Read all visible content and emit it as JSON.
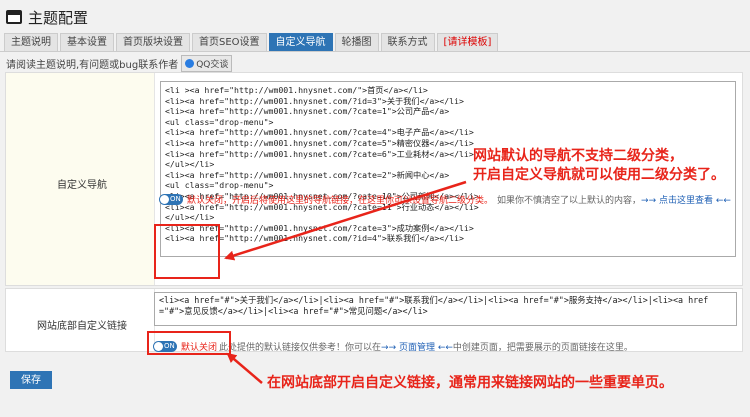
{
  "header": {
    "title": "主题配置"
  },
  "tabs": [
    {
      "label": "主题说明"
    },
    {
      "label": "基本设置"
    },
    {
      "label": "首页版块设置"
    },
    {
      "label": "首页SEO设置"
    },
    {
      "label": "自定义导航"
    },
    {
      "label": "轮播图"
    },
    {
      "label": "联系方式"
    },
    {
      "label": "[请详模板]"
    }
  ],
  "notice": {
    "text": "请阅读主题说明,有问题或bug联系作者",
    "qq_label": "QQ交谈"
  },
  "nav": {
    "label": "自定义导航",
    "code": "<li ><a href=\"http://wm001.hnysnet.com/\">首页</a></li>\n<li><a href=\"http://wm001.hnysnet.com/?id=3\">关于我们</a></li>\n<li><a href=\"http://wm001.hnysnet.com/?cate=1\">公司产品</a>\n<ul class=\"drop-menu\">\n<li><a href=\"http://wm001.hnysnet.com/?cate=4\">电子产品</a></li>\n<li><a href=\"http://wm001.hnysnet.com/?cate=5\">精密仪器</a></li>\n<li><a href=\"http://wm001.hnysnet.com/?cate=6\">工业耗材</a></li>\n</ul></li>\n<li><a href=\"http://wm001.hnysnet.com/?cate=2\">新闻中心</a>\n<ul class=\"drop-menu\">\n<li><a href=\"http://wm001.hnysnet.com/?cate=10\">公司新闻</a></li>\n<li><a href=\"http://wm001.hnysnet.com/?cate=11\">行业动态</a></li>\n</ul></li>\n<li><a href=\"http://wm001.hnysnet.com/?cate=3\">成功案例</a></li>\n<li><a href=\"http://wm001.hnysnet.com/?id=4\">联系我们</a></li>",
    "toggle_label": "ON",
    "toggle_default": "默认关闭",
    "hint_red": "，开启后将使用这里的导航链接，在这里你可以设置导航二级分类。",
    "hint_gray": "如果你不慎清空了以上默认的内容，",
    "hint_blue": "→→ 点击这里查看 ←←"
  },
  "footer_nav": {
    "label": "网站底部自定义链接",
    "code": "<li><a href=\"#\">关于我们</a></li>|<li><a href=\"#\">联系我们</a></li>|<li><a href=\"#\">服务支持</a></li>|<li><a href=\"#\">意见反馈</a></li>|<li><a href=\"#\">常见问题</a></li>",
    "toggle_label": "ON",
    "toggle_default": "默认关闭",
    "hint_pre": "此处提供的默认链接仅供参考！你可以在",
    "hint_link": "→→ 页面管理 ←←",
    "hint_post": "中创建页面，把需要展示的页面链接在这里。"
  },
  "save_label": "保存",
  "annotations": {
    "top_line1": "网站默认的导航不支持二级分类，",
    "top_line2": "开启自定义导航就可以使用二级分类了。",
    "bottom": "在网站底部开启自定义链接，通常用来链接网站的一些重要单页。"
  },
  "colors": {
    "accent": "#2e74b5",
    "annotation": "#e8241a"
  }
}
